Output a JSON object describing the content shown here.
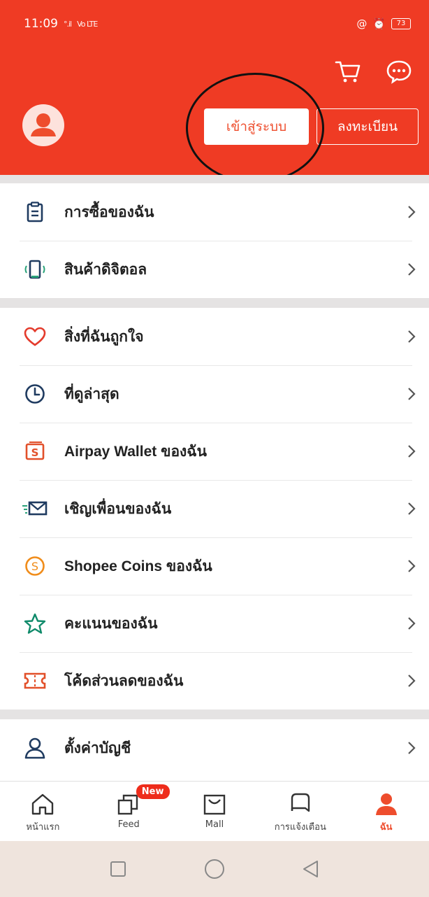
{
  "status_bar": {
    "time": "11:09",
    "signal": "°.il",
    "network": "Vo LTE",
    "battery": "73"
  },
  "header": {
    "login_label": "เข้าสู่ระบบ",
    "register_label": "ลงทะเบียน"
  },
  "menu": {
    "group1": [
      {
        "label": "การซื้อของฉัน",
        "icon": "clipboard-icon"
      },
      {
        "label": "สินค้าดิจิตอล",
        "icon": "phone-icon"
      }
    ],
    "group2": [
      {
        "label": "สิ่งที่ฉันถูกใจ",
        "icon": "heart-icon"
      },
      {
        "label": "ที่ดูล่าสุด",
        "icon": "clock-icon"
      },
      {
        "label": "Airpay Wallet ของฉัน",
        "icon": "wallet-icon"
      },
      {
        "label": "เชิญเพื่อนของฉัน",
        "icon": "envelope-icon"
      },
      {
        "label": "Shopee Coins ของฉัน",
        "icon": "coin-icon"
      },
      {
        "label": "คะแนนของฉัน",
        "icon": "star-icon"
      },
      {
        "label": "โค้ดส่วนลดของฉัน",
        "icon": "voucher-icon"
      }
    ],
    "group3": [
      {
        "label": "ตั้งค่าบัญชี",
        "icon": "user-icon"
      }
    ]
  },
  "bottom_nav": {
    "items": [
      {
        "label": "หน้าแรก",
        "icon": "home-icon"
      },
      {
        "label": "Feed",
        "icon": "feed-icon",
        "badge": "New"
      },
      {
        "label": "Mall",
        "icon": "mall-icon"
      },
      {
        "label": "การแจ้งเตือน",
        "icon": "bell-icon"
      },
      {
        "label": "ฉัน",
        "icon": "profile-icon",
        "active": true
      }
    ]
  },
  "colors": {
    "brand": "#ee4d2d",
    "header_bg": "#ef3b24"
  }
}
